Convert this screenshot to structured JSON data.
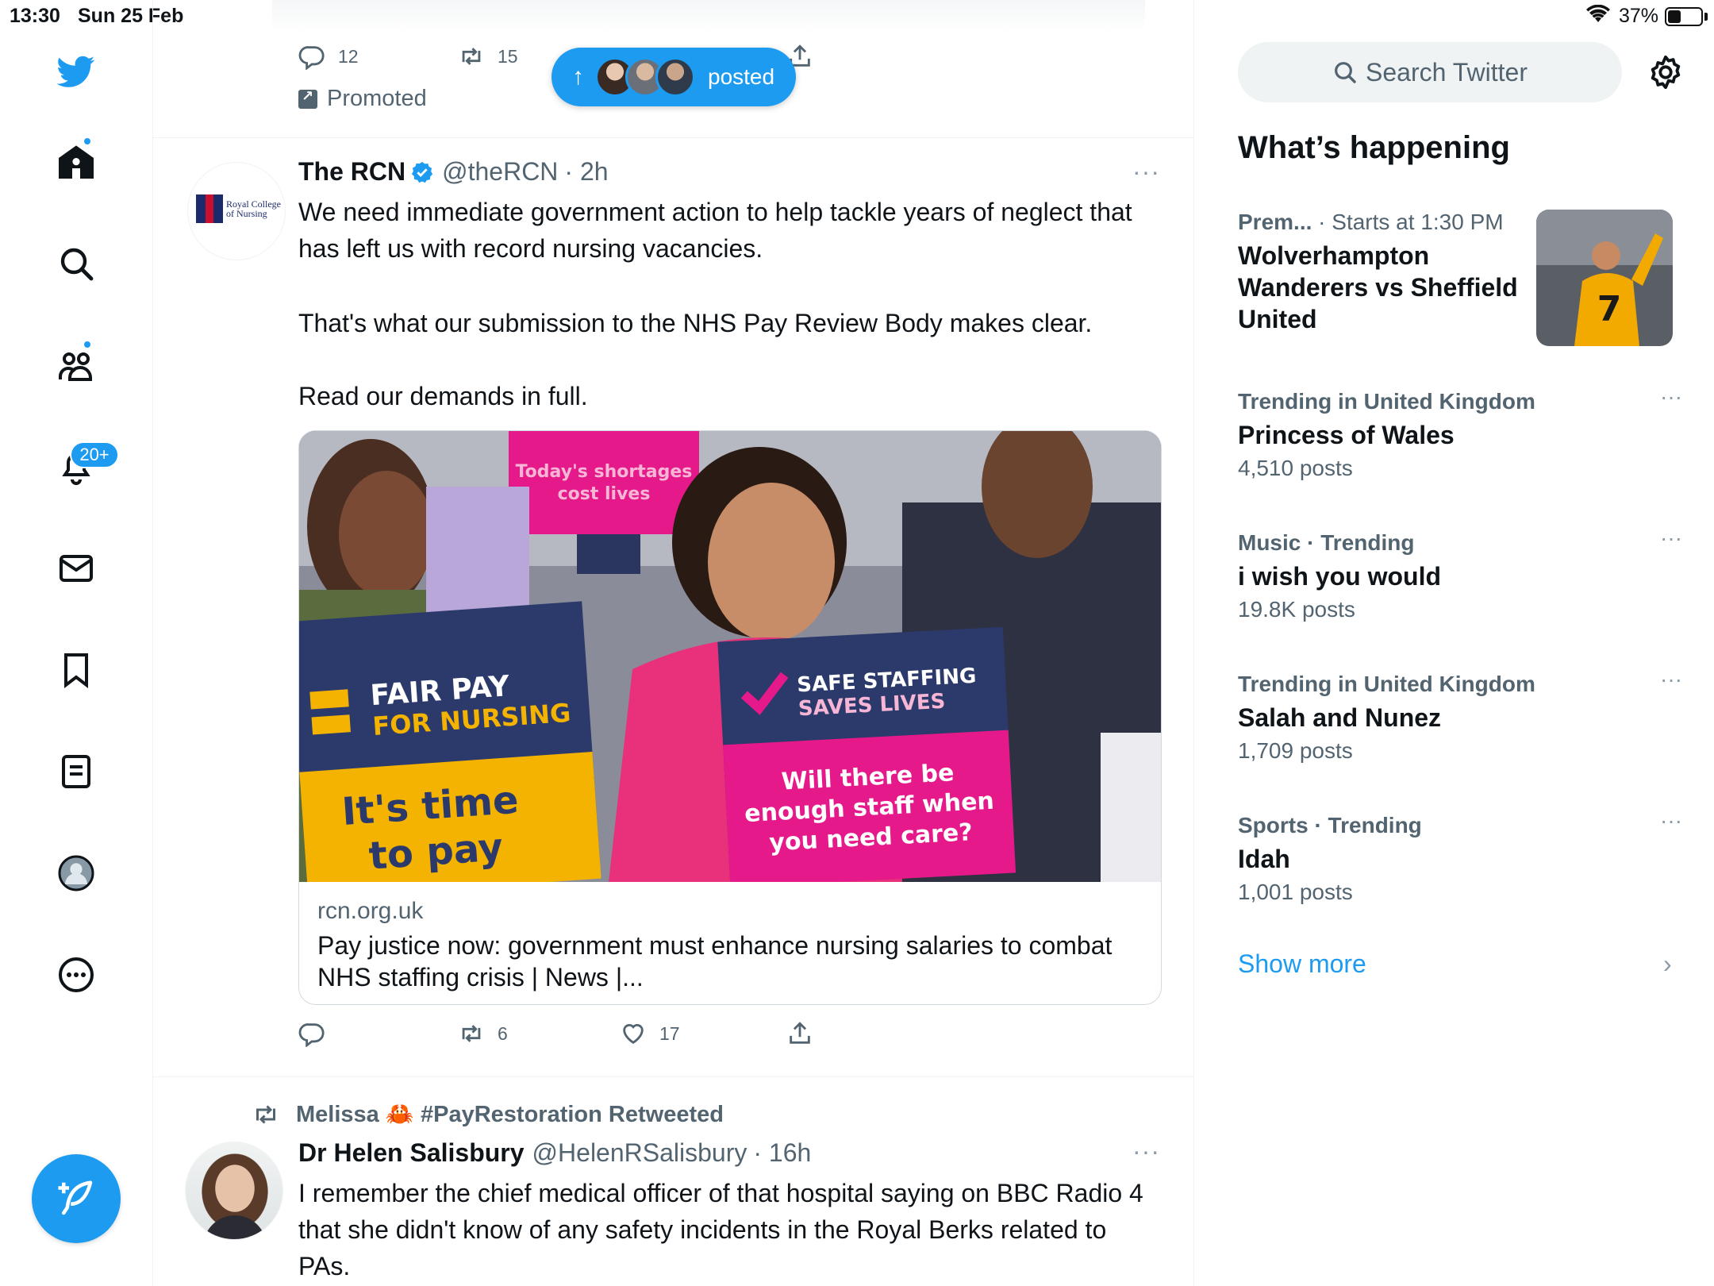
{
  "status_bar": {
    "time": "13:30",
    "date": "Sun 25 Feb",
    "battery": "37%",
    "dots": "•••"
  },
  "nav": {
    "items": [
      "home",
      "explore",
      "communities",
      "notifications",
      "messages",
      "bookmarks",
      "lists",
      "profile",
      "more"
    ],
    "notifications_badge": "20+"
  },
  "promoted_tweet": {
    "reply_count": "12",
    "retweet_count": "15",
    "promoted_label": "Promoted"
  },
  "new_posts_pill": {
    "arrow": "↑",
    "label": "posted"
  },
  "tweet1": {
    "name": "The RCN",
    "handle": "@theRCN",
    "time": "· 2h",
    "more": "···",
    "logo_text_1": "Royal College",
    "logo_text_2": "of Nursing",
    "text_1": "We need immediate government action to help tackle years of neglect that has left us with record nursing vacancies.",
    "text_2": "That's what our submission to the NHS Pay Review Body makes clear.",
    "text_3": "Read our demands in full.",
    "image_signs": {
      "sign1a": "FAIR PAY",
      "sign1b": "FOR NURSING",
      "sign1c": "It's time",
      "sign1d": "to pay",
      "sign2a": "SAFE STAFFING",
      "sign2b": "SAVES LIVES",
      "sign2c": "Will there be",
      "sign2d": "enough staff when",
      "sign2e": "you need care?",
      "sign3a": "Today's shortages",
      "sign3b": "cost lives"
    },
    "card_domain": "rcn.org.uk",
    "card_title": "Pay justice now: government must enhance nursing salaries to combat NHS staffing crisis | News |...",
    "retweet_count": "6",
    "like_count": "17"
  },
  "tweet2": {
    "retweeted_by": "Melissa 🦀 #PayRestoration Retweeted",
    "name": "Dr Helen Salisbury",
    "handle": "@HelenRSalisbury",
    "time": "· 16h",
    "more": "···",
    "text": "I remember the chief medical officer of that hospital saying on BBC Radio 4 that she didn't know of any safety incidents in the Royal Berks related to PAs."
  },
  "sidebar": {
    "search_placeholder": "Search Twitter",
    "heading": "What’s happening",
    "event": {
      "context_a": "Prem...",
      "context_b": " · Starts at 1:30 PM",
      "title": "Wolverhampton Wanderers vs Sheffield United"
    },
    "trends": [
      {
        "context": "Trending in United Kingdom",
        "title": "Princess of Wales",
        "count": "4,510 posts",
        "more": "···"
      },
      {
        "context": "Music · Trending",
        "title": "i wish you would",
        "count": "19.8K posts",
        "more": "···"
      },
      {
        "context": "Trending in United Kingdom",
        "title": "Salah and Nunez",
        "count": "1,709 posts",
        "more": "···"
      },
      {
        "context": "Sports · Trending",
        "title": "Idah",
        "count": "1,001 posts",
        "more": "···"
      }
    ],
    "show_more": "Show more",
    "chevron": "›"
  },
  "colors": {
    "accent": "#1d9bf0",
    "text": "#0f1419",
    "secondary": "#536471",
    "border": "#eff3f4"
  }
}
